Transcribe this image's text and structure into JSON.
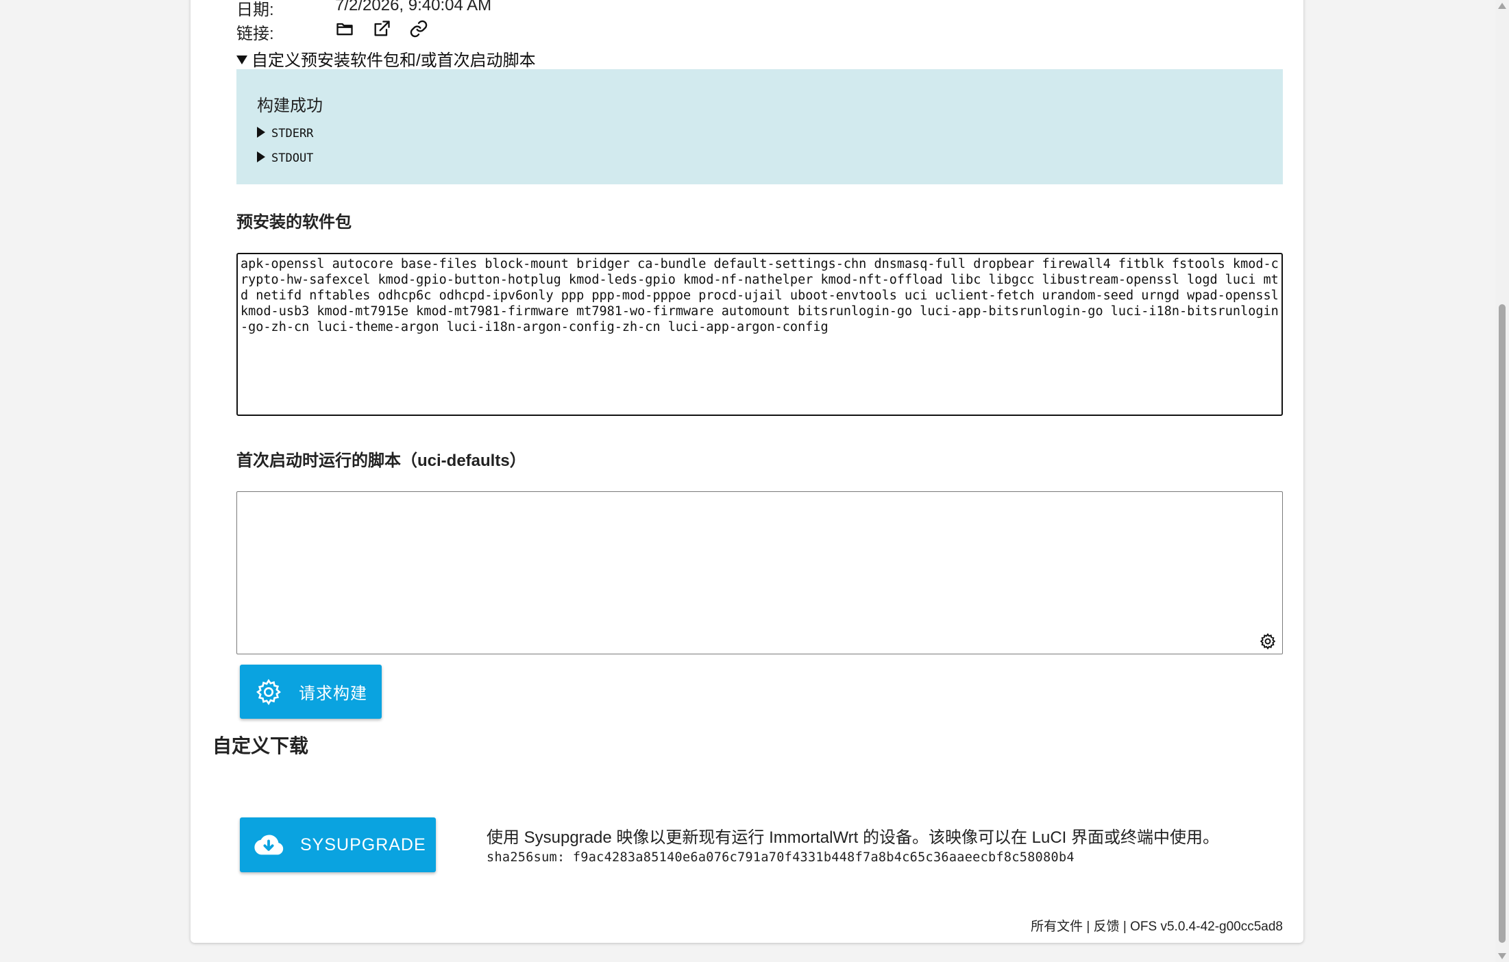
{
  "meta": {
    "date_label": "日期:",
    "date_value": "7/2/2026, 9:40:04 AM",
    "links_label": "链接:",
    "link_icons": [
      "folder-icon",
      "external-link-icon",
      "chain-link-icon"
    ]
  },
  "custom_section": {
    "summary": "自定义预安装软件包和/或首次启动脚本",
    "build_status": {
      "title": "构建成功",
      "stderr_label": "STDERR",
      "stdout_label": "STDOUT",
      "background": "#d2eaee"
    },
    "packages_label": "预安装的软件包",
    "packages_value": "apk-openssl autocore base-files block-mount bridger ca-bundle default-settings-chn dnsmasq-full dropbear firewall4 fitblk fstools kmod-crypto-hw-safexcel kmod-gpio-button-hotplug kmod-leds-gpio kmod-nf-nathelper kmod-nft-offload libc libgcc libustream-openssl logd luci mtd netifd nftables odhcp6c odhcpd-ipv6only ppp ppp-mod-pppoe procd-ujail uboot-envtools uci uclient-fetch urandom-seed urngd wpad-openssl kmod-usb3 kmod-mt7915e kmod-mt7981-firmware mt7981-wo-firmware automount bitsrunlogin-go luci-app-bitsrunlogin-go luci-i18n-bitsrunlogin-go-zh-cn luci-theme-argon luci-i18n-argon-config-zh-cn luci-app-argon-config",
    "script_label": "首次启动时运行的脚本（uci-defaults）",
    "script_value": "",
    "request_build_label": "请求构建"
  },
  "downloads": {
    "heading": "自定义下载",
    "sysupgrade_label": "SYSUPGRADE",
    "sysupgrade_desc": "使用 Sysupgrade 映像以更新现有运行 ImmortalWrt 的设备。该映像可以在 LuCI 界面或终端中使用。",
    "sha256": "sha256sum: f9ac4283a85140e6a076c791a70f4331b448f7a8b4c65c36aaeecbf8c58080b4"
  },
  "footer": {
    "all_files": "所有文件",
    "sep1": " | ",
    "feedback": "反馈",
    "sep2": " | ",
    "version": "OFS v5.0.4-42-g00cc5ad8"
  },
  "colors": {
    "accent_button": "#0aa3e0",
    "status_box": "#d2eaee",
    "page_bg": "#f3f3f3"
  }
}
